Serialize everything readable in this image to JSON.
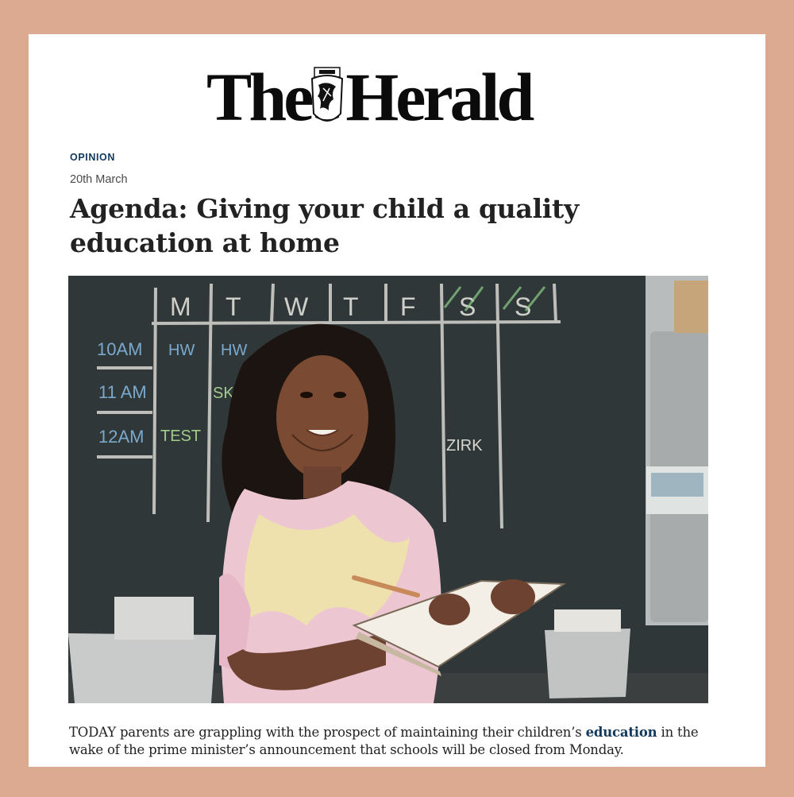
{
  "site": {
    "name_part1": "The",
    "name_part2": "Herald",
    "crest_icon": "heraldic-crest-icon"
  },
  "article": {
    "category": "OPINION",
    "date": "20th March",
    "headline": "Agenda: Giving your child a quality education at home",
    "lede": {
      "before": "TODAY parents are grappling with the prospect of maintaining their children’s ",
      "link": "education",
      "after": " in the wake of the prime minister’s announcement that schools will be closed from Monday."
    }
  },
  "photo": {
    "chalk_days": [
      "M",
      "T",
      "W",
      "T",
      "F",
      "S",
      "S"
    ],
    "chalk_times": [
      "10AM",
      "11 AM",
      "12AM"
    ],
    "chalk_entries": [
      "HW",
      "HW",
      "SKY",
      "TEST",
      "ZIRK"
    ]
  },
  "colors": {
    "frame": "#dcaa90",
    "category": "#12395e",
    "link": "#12395e",
    "chalkboard": "#2c3233"
  }
}
